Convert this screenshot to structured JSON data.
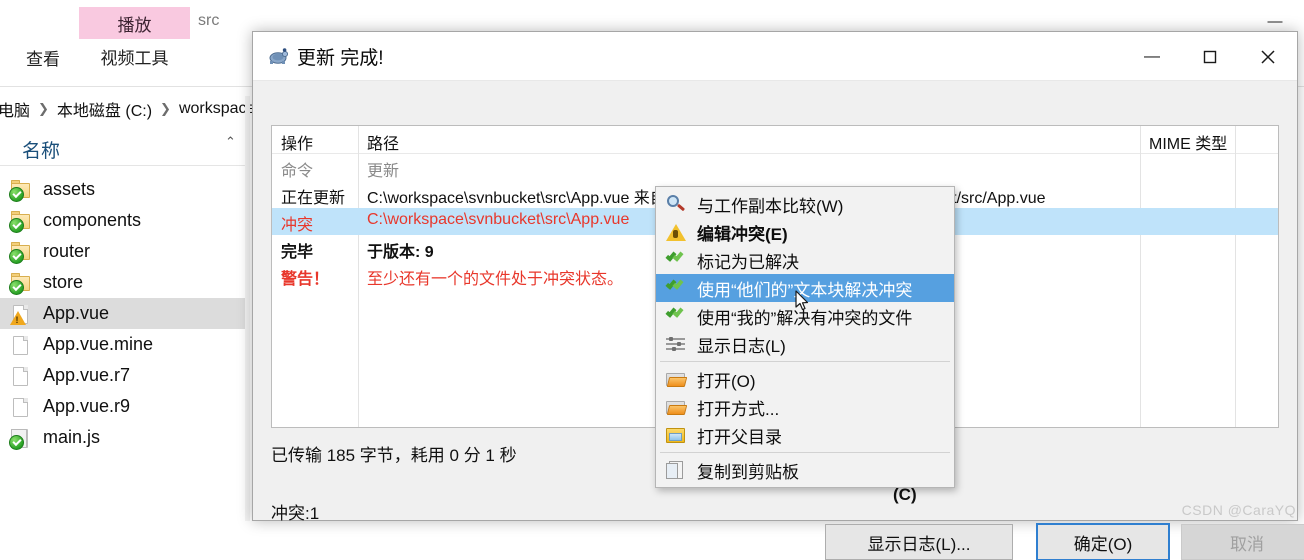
{
  "explorer": {
    "ribbon": {
      "tab_play": "播放",
      "tab_video_tools": "视频工具",
      "tab_view": "查看",
      "window_title": "src"
    },
    "breadcrumb": [
      "电脑",
      "本地磁盘 (C:)",
      "workspace"
    ],
    "column_header": "名称",
    "files": [
      {
        "name": "assets",
        "icon": "folder-ok-icon"
      },
      {
        "name": "components",
        "icon": "folder-ok-icon"
      },
      {
        "name": "router",
        "icon": "folder-ok-icon"
      },
      {
        "name": "store",
        "icon": "folder-ok-icon"
      },
      {
        "name": "App.vue",
        "icon": "file-warning-icon",
        "selected": true
      },
      {
        "name": "App.vue.mine",
        "icon": "file-icon"
      },
      {
        "name": "App.vue.r7",
        "icon": "file-icon"
      },
      {
        "name": "App.vue.r9",
        "icon": "file-icon"
      },
      {
        "name": "main.js",
        "icon": "file-js-ok-icon"
      }
    ],
    "window_controls": {
      "minimize": "—",
      "maximize": "▢",
      "close": "✕"
    }
  },
  "dialog": {
    "title": "更新 完成!",
    "title_icon": "tortoise-svn-icon",
    "window_controls": {
      "minimize": "—",
      "maximize": "▢",
      "close": "✕"
    },
    "log_columns": {
      "action": "操作",
      "path": "路径",
      "mime": "MIME 类型"
    },
    "log_rows": [
      {
        "action": "命令",
        "path": "更新",
        "action_color": "#8a8a8a",
        "path_color": "#8a8a8a"
      },
      {
        "action": "正在更新",
        "path": "C:\\workspace\\svnbucket\\src\\App.vue 来自 svn://svnbucket.com/learnsvn/svnbucket/src/App.vue",
        "action_color": "#101010",
        "path_color": "#101010"
      },
      {
        "action": "冲突",
        "path": "C:\\workspace\\svnbucket\\src\\App.vue",
        "action_color": "#e8372b",
        "path_color": "#e8372b",
        "selected": true
      },
      {
        "action": "完毕",
        "path": "于版本: 9",
        "action_color": "#101010",
        "path_color": "#101010",
        "bold": true
      },
      {
        "action": "警告！",
        "path": "至少还有一个的文件处于冲突状态。",
        "action_color": "#e8372b",
        "path_color": "#e8372b"
      }
    ],
    "transfer_status": "已传输 185 字节，耗用 0 分 1 秒",
    "conflict_status": "冲突:1",
    "obscured_text_fragment": "(C)",
    "buttons": {
      "show_log": "显示日志(L)...",
      "ok": "确定(O)",
      "cancel": "取消"
    }
  },
  "context_menu": {
    "items": [
      {
        "label": "与工作副本比较(W)",
        "icon": "magnifier-icon",
        "bold": false,
        "highlighted": false
      },
      {
        "label": "编辑冲突(E)",
        "icon": "warning-icon",
        "bold": true,
        "highlighted": false
      },
      {
        "label": "标记为已解决",
        "icon": "checkmarks-icon",
        "bold": false,
        "highlighted": false
      },
      {
        "label": "使用“他们的”文本块解决冲突",
        "icon": "checkmarks-icon",
        "bold": false,
        "highlighted": true
      },
      {
        "label": "使用“我的”解决有冲突的文件",
        "icon": "checkmarks-icon",
        "bold": false,
        "highlighted": false
      },
      {
        "label": "显示日志(L)",
        "icon": "log-lines-icon",
        "bold": false,
        "highlighted": false
      },
      {
        "separator": true
      },
      {
        "label": "打开(O)",
        "icon": "open-folder-icon",
        "bold": false,
        "highlighted": false
      },
      {
        "label": "打开方式...",
        "icon": "open-folder-icon",
        "bold": false,
        "highlighted": false
      },
      {
        "label": "打开父目录",
        "icon": "parent-folder-icon",
        "bold": false,
        "highlighted": false
      },
      {
        "separator": true
      },
      {
        "label": "复制到剪贴板",
        "icon": "clipboard-icon",
        "bold": false,
        "highlighted": false
      }
    ]
  },
  "watermark": "CSDN @CaraYQ",
  "colors": {
    "selection_blue": "#bfe3fa",
    "menu_highlight": "#56a0e0",
    "conflict_red": "#e8372b",
    "ribbon_pink": "#f9c9e0",
    "ok_green": "#27a024"
  }
}
